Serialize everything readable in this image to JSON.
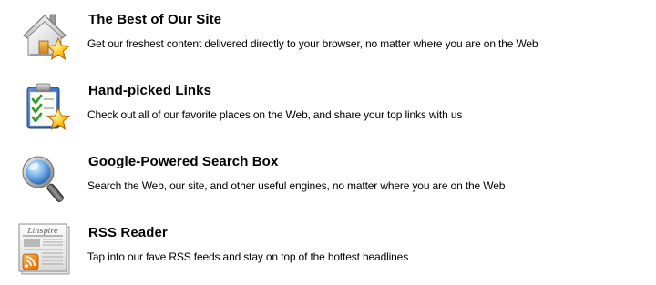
{
  "features": [
    {
      "title": "The Best of Our Site",
      "description": "Get our freshest content delivered directly to your browser, no matter where you are on the Web",
      "icon": "home-star-icon"
    },
    {
      "title": "Hand-picked Links",
      "description": "Check out all of our favorite places on the Web, and share your top links with us",
      "icon": "clipboard-checklist-star-icon"
    },
    {
      "title": "Google-Powered Search Box",
      "description": "Search the Web, our site, and other useful engines, no matter where you are on the Web",
      "icon": "magnifying-glass-icon"
    },
    {
      "title": "RSS Reader",
      "description": "Tap into our fave RSS feeds and stay on top of the hottest headlines",
      "icon": "newspaper-rss-icon",
      "icon_text": "Linspire"
    }
  ]
}
